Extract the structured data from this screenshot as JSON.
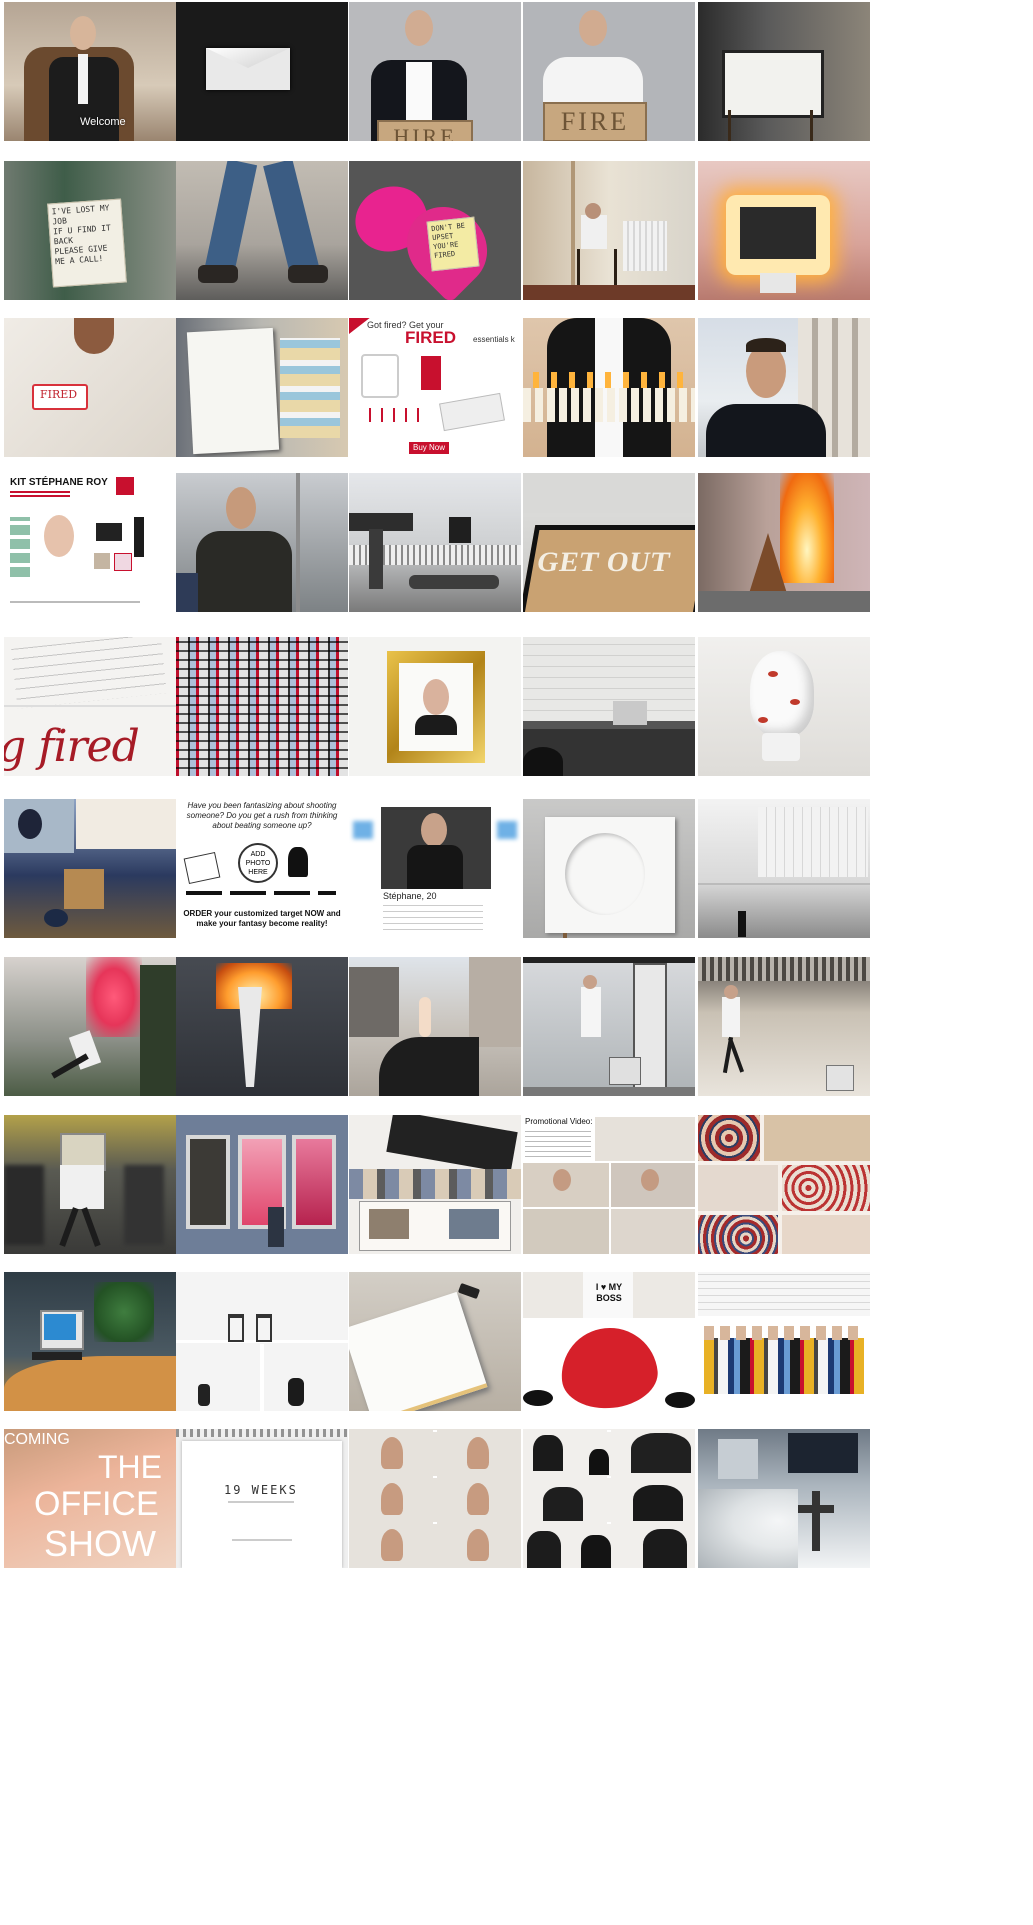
{
  "tiles": [
    {
      "alt": "Man in suit seated in armchair",
      "caption": "Welcome"
    },
    {
      "alt": "Envelope on black background"
    },
    {
      "alt": "Man holding HIRE sign",
      "sign": "HIRE"
    },
    {
      "alt": "Man holding FIRE sign",
      "sign": "FIRE"
    },
    {
      "alt": "Easel with sign in dark room"
    },
    {
      "alt": "Lost job notice on pole",
      "note": "I'VE LOST MY JOB\nIF U FIND IT BACK\nPLEASE GIVE ME A CALL!"
    },
    {
      "alt": "Legs walking on street"
    },
    {
      "alt": "Pink heart box with note",
      "note": "DON'T BE UPSET YOU'RE FIRED"
    },
    {
      "alt": "Man sitting facing corner"
    },
    {
      "alt": "Burning computer monitor"
    },
    {
      "alt": "Shirt with name tag",
      "tag": "FIRED"
    },
    {
      "alt": "Letter on board with notes"
    },
    {
      "alt": "Fired essentials kit ad",
      "ad_title": "Got fired? Get your",
      "ad_brand": "FIRED",
      "ad_suffix": "essentials k",
      "ad_button": "Buy Now"
    },
    {
      "alt": "Man with paper chain of burning figures"
    },
    {
      "alt": "Smiling man in coat on street"
    },
    {
      "alt": "Kit Stéphane Roy product sheet",
      "kit_title": "KIT STÉPHANE ROY"
    },
    {
      "alt": "Man in coat on tram"
    },
    {
      "alt": "Desk and chair abandoned outside"
    },
    {
      "alt": "Doormat with GET OUT text",
      "mat": "GET OUT"
    },
    {
      "alt": "Christmas tree on fire"
    },
    {
      "alt": "Embroidered fired text",
      "embroid": "g fired"
    },
    {
      "alt": "Wall covered in printed cards"
    },
    {
      "alt": "Framed portrait on wall"
    },
    {
      "alt": "Empty desk with laptop"
    },
    {
      "alt": "White bust with red kisses"
    },
    {
      "alt": "Collage of man sitting on floor"
    },
    {
      "alt": "Target advertisement",
      "target_q": "Have you been fantasizing about shooting someone? Do you get a rush from thinking about beating someone up?",
      "target_add": "ADD PHOTO HERE",
      "target_cta": "ORDER your customized target NOW and make your fantasy become reality!"
    },
    {
      "alt": "Dating profile screenshot",
      "profile": "Stéphane, 20"
    },
    {
      "alt": "White canvas on easel"
    },
    {
      "alt": "Person in white gallery"
    },
    {
      "alt": "Red smoke over man on steps"
    },
    {
      "alt": "Burning paper torch"
    },
    {
      "alt": "Middle finger on busy street"
    },
    {
      "alt": "Man at bus stop with computer"
    },
    {
      "alt": "Man walking in arcade with computer"
    },
    {
      "alt": "Man carrying monitor on head"
    },
    {
      "alt": "Shop windows with red light"
    },
    {
      "alt": "Photo book spread"
    },
    {
      "alt": "Promotional video collage",
      "promo": "Promotional Video: Stéphane Roy"
    },
    {
      "alt": "Carpets and empty office collage"
    },
    {
      "alt": "Office desk with computer"
    },
    {
      "alt": "Empty chairs in white room"
    },
    {
      "alt": "Document with pen on table"
    },
    {
      "alt": "I love my boss shirt and red heart",
      "shirt": "I ♥ MY BOSS"
    },
    {
      "alt": "Group of workers in uniforms"
    },
    {
      "alt": "Coming The Office Show poster",
      "poster": [
        "COMING",
        "THE",
        "OFFICE",
        "SHOW"
      ]
    },
    {
      "alt": "19 weeks document",
      "doc": "19 WEEKS"
    },
    {
      "alt": "Grid of portraits of man"
    },
    {
      "alt": "Audience seated in dark room"
    },
    {
      "alt": "Cemetery cross and screens"
    }
  ]
}
